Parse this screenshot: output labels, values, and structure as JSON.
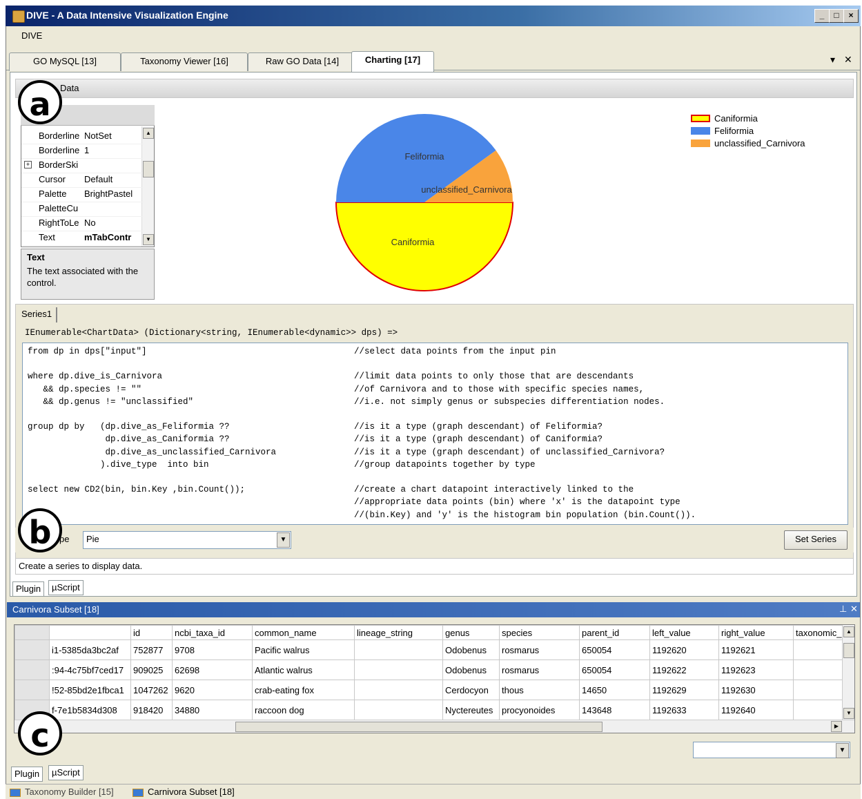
{
  "window": {
    "title": "DIVE - A Data Intensive Visualization Engine"
  },
  "menu": {
    "item": "DIVE"
  },
  "doc_tabs": [
    "GO MySQL [13]",
    "Taxonomy Viewer [16]",
    "Raw GO Data [14]",
    "Charting [17]"
  ],
  "data_header": "Data",
  "properties": [
    {
      "name": "Borderline",
      "value": "NotSet",
      "expand": false
    },
    {
      "name": "Borderline",
      "value": "1",
      "expand": false
    },
    {
      "name": "BorderSki",
      "value": "",
      "expand": true
    },
    {
      "name": "Cursor",
      "value": "Default",
      "expand": false
    },
    {
      "name": "Palette",
      "value": "BrightPastel",
      "expand": false
    },
    {
      "name": "PaletteCu",
      "value": "",
      "expand": false
    },
    {
      "name": "RightToLe",
      "value": "No",
      "expand": false
    },
    {
      "name": "Text",
      "value": "mTabContr",
      "expand": false
    }
  ],
  "prop_desc": {
    "title": "Text",
    "body": "The text associated with the control."
  },
  "chart_data": {
    "type": "pie",
    "slices": [
      {
        "label": "Caniformia",
        "value": 50,
        "color": "#ffff00"
      },
      {
        "label": "Feliformia",
        "value": 40,
        "color": "#4a86e8"
      },
      {
        "label": "unclassified_Carnivora",
        "value": 10,
        "color": "#f9a33c"
      }
    ],
    "legend": [
      {
        "label": "Caniformia",
        "color": "#ffff00",
        "border": "#e00000"
      },
      {
        "label": "Feliformia",
        "color": "#4a86e8",
        "border": "#4a86e8"
      },
      {
        "label": "unclassified_Carnivora",
        "color": "#f9a33c",
        "border": "#f9a33c"
      }
    ],
    "legend_position": "top-right"
  },
  "series_tab": "Series1",
  "code_signature": "IEnumerable<ChartData> (Dictionary<string, IEnumerable<dynamic>> dps) =>",
  "code": [
    {
      "code": "from dp in dps[\"input\"]",
      "comment": "//select data points from the input pin"
    },
    {
      "code": "",
      "comment": ""
    },
    {
      "code": "where dp.dive_is_Carnivora",
      "comment": "//limit data points to only those that are descendants"
    },
    {
      "code": "   && dp.species != \"\"",
      "comment": "//of Carnivora and to those with specific species names,"
    },
    {
      "code": "   && dp.genus != \"unclassified\"",
      "comment": "//i.e. not simply genus or subspecies differentiation nodes."
    },
    {
      "code": "",
      "comment": ""
    },
    {
      "code": "group dp by   (dp.dive_as_Feliformia ??",
      "comment": "//is it a type (graph descendant) of Feliformia?"
    },
    {
      "code": "               dp.dive_as_Caniformia ??",
      "comment": "//is it a type (graph descendant) of Caniformia?"
    },
    {
      "code": "               dp.dive_as_unclassified_Carnivora",
      "comment": "//is it a type (graph descendant) of unclassified_Carnivora?"
    },
    {
      "code": "              ).dive_type  into bin",
      "comment": "//group datapoints together by type"
    },
    {
      "code": "",
      "comment": ""
    },
    {
      "code": "select new CD2(bin, bin.Key ,bin.Count());",
      "comment": "//create a chart datapoint interactively linked to the"
    },
    {
      "code": "",
      "comment": "//appropriate data points (bin) where 'x' is the datapoint type"
    },
    {
      "code": "",
      "comment": "//(bin.Key) and 'y' is the histogram bin population (bin.Count())."
    }
  ],
  "type_label": "pe",
  "type_value": "Pie",
  "set_series": "Set Series",
  "status": "Create a series to display data.",
  "plugin_tabs": [
    "Plugin",
    "µScript"
  ],
  "panel_title": "Carnivora Subset [18]",
  "grid": {
    "headers": [
      "",
      "id",
      "ncbi_taxa_id",
      "common_name",
      "lineage_string",
      "genus",
      "species",
      "parent_id",
      "left_value",
      "right_value",
      "taxonomic_"
    ],
    "rows": [
      [
        "i1-5385da3bc2af",
        "752877",
        "9708",
        "Pacific walrus",
        "",
        "Odobenus",
        "rosmarus",
        "650054",
        "1192620",
        "1192621",
        ""
      ],
      [
        ":94-4c75bf7ced17",
        "909025",
        "62698",
        "Atlantic walrus",
        "",
        "Odobenus",
        "rosmarus",
        "650054",
        "1192622",
        "1192623",
        ""
      ],
      [
        "!52-85bd2e1fbca1",
        "1047262",
        "9620",
        "crab-eating fox",
        "",
        "Cerdocyon",
        "thous",
        "14650",
        "1192629",
        "1192630",
        ""
      ],
      [
        "f-7e1b5834d308",
        "918420",
        "34880",
        "raccoon dog",
        "",
        "Nyctereutes",
        "procyonoides",
        "143648",
        "1192633",
        "1192640",
        ""
      ]
    ]
  },
  "bottom_tabs": [
    "Taxonomy Builder [15]",
    "Carnivora Subset [18]"
  ],
  "annotations": [
    "a",
    "b",
    "c"
  ]
}
